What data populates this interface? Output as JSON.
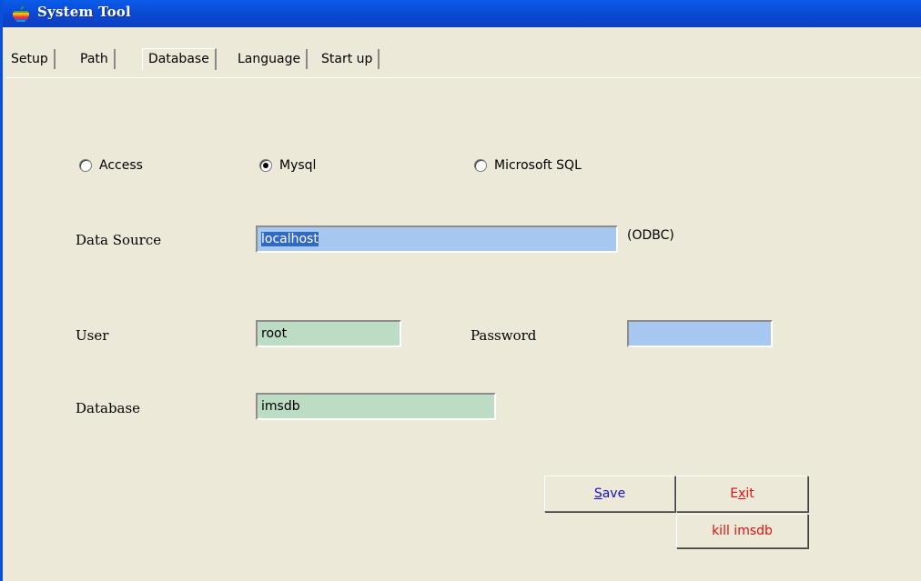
{
  "window": {
    "title": "System Tool"
  },
  "tabs": [
    {
      "label": "Setup"
    },
    {
      "label": "Path"
    },
    {
      "label": "Database"
    },
    {
      "label": "Language"
    },
    {
      "label": "Start up"
    }
  ],
  "active_tab": "Database",
  "db_type": {
    "options": [
      {
        "label": "Access",
        "checked": false
      },
      {
        "label": "Mysql",
        "checked": true
      },
      {
        "label": "Microsoft SQL",
        "checked": false
      }
    ]
  },
  "data_source": {
    "label": "Data Source",
    "value": "localhost",
    "suffix": "(ODBC)"
  },
  "user": {
    "label": "User",
    "value": "root"
  },
  "password": {
    "label": "Password",
    "value": ""
  },
  "database": {
    "label": "Database",
    "value": "imsdb"
  },
  "buttons": {
    "save": {
      "mnemonic": "S",
      "rest": "ave"
    },
    "exit": {
      "prefix": "E",
      "mnemonic": "x",
      "rest": "it"
    },
    "kill": {
      "label": "kill imsdb"
    }
  },
  "colors": {
    "titlebar": "#0a4fd8",
    "field_blue": "#a6c8f0",
    "field_green": "#bcdcc4",
    "exit_text": "#e01010",
    "save_text": "#1111cc"
  }
}
